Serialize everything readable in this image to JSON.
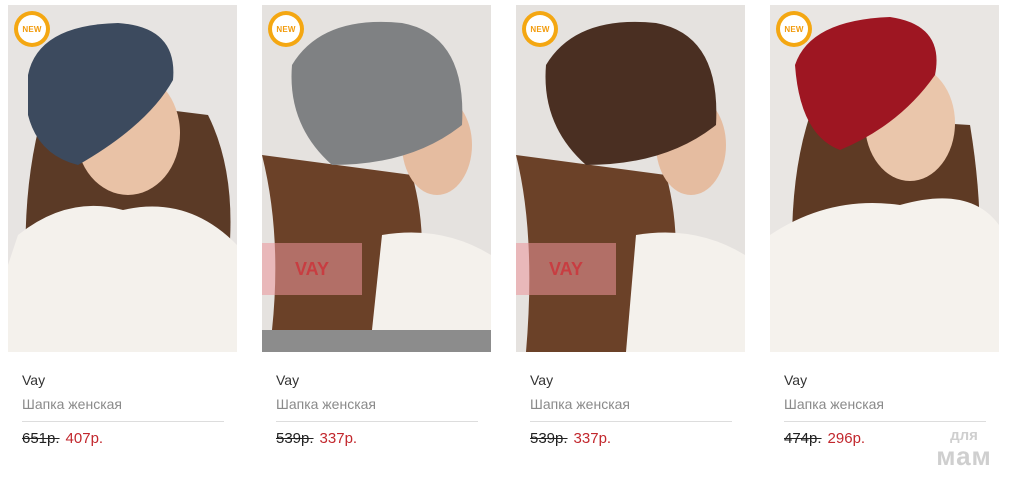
{
  "badge_label": "NEW",
  "watermark_text": "VAY",
  "site_logo": {
    "top": "для",
    "bottom": "мам"
  },
  "colors": {
    "badge": "#f4a712",
    "sale_price": "#c2272d"
  },
  "products": [
    {
      "brand": "Vay",
      "title": "Шапка женская",
      "old_price": "651р.",
      "price": "407р.",
      "hat_color": "#3c4a5e"
    },
    {
      "brand": "Vay",
      "title": "Шапка женская",
      "old_price": "539р.",
      "price": "337р.",
      "hat_color": "#7f8183"
    },
    {
      "brand": "Vay",
      "title": "Шапка женская",
      "old_price": "539р.",
      "price": "337р.",
      "hat_color": "#4a2f22"
    },
    {
      "brand": "Vay",
      "title": "Шапка женская",
      "old_price": "474р.",
      "price": "296р.",
      "hat_color": "#9e1622"
    }
  ]
}
